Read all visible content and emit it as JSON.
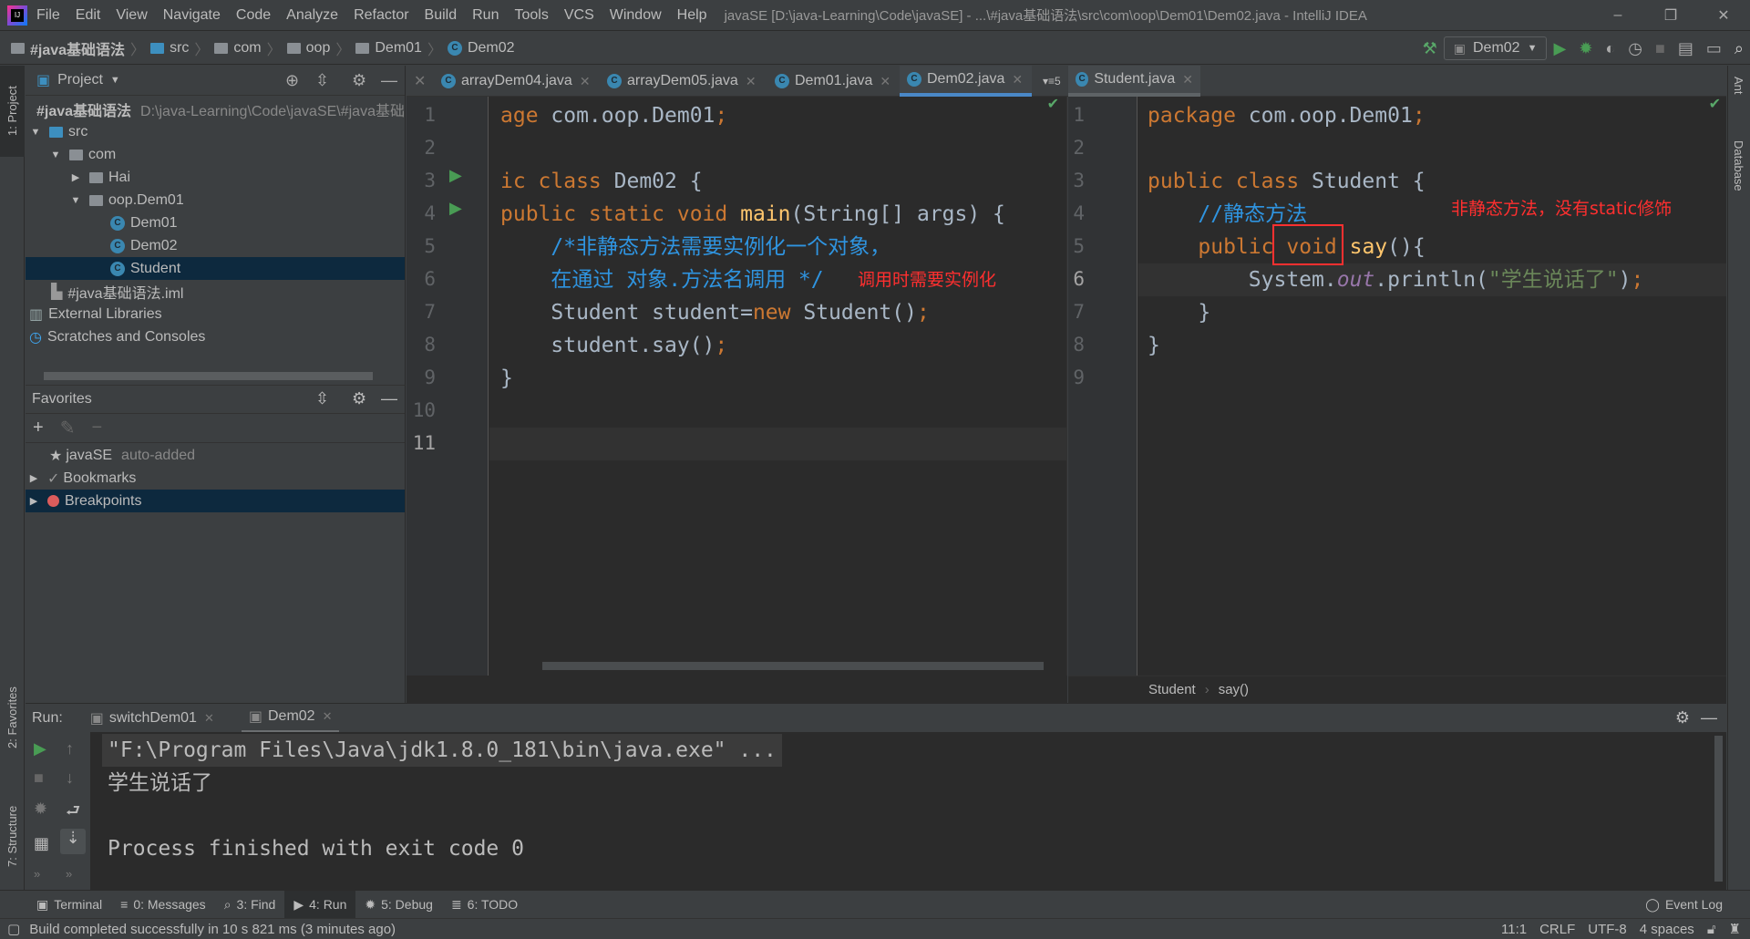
{
  "window": {
    "title": "javaSE [D:\\java-Learning\\Code\\javaSE] - ...\\#java基础语法\\src\\com\\oop\\Dem01\\Dem02.java - IntelliJ IDEA",
    "minimize": "–",
    "restore": "❐",
    "close": "✕"
  },
  "menu": [
    "File",
    "Edit",
    "View",
    "Navigate",
    "Code",
    "Analyze",
    "Refactor",
    "Build",
    "Run",
    "Tools",
    "VCS",
    "Window",
    "Help"
  ],
  "breadcrumb": [
    "#java基础语法",
    "src",
    "com",
    "oop",
    "Dem01",
    "Dem02"
  ],
  "run_config": "Dem02",
  "left_stripe": {
    "project": "1: Project",
    "favorites": "2: Favorites",
    "structure": "7: Structure"
  },
  "right_stripe": {
    "ant": "Ant",
    "database": "Database"
  },
  "project": {
    "title": "Project",
    "tree": [
      {
        "label": "#java基础语法",
        "extra": "D:\\java-Learning\\Code\\javaSE\\#java基础语法"
      },
      {
        "label": "src"
      },
      {
        "label": "com"
      },
      {
        "label": "Hai"
      },
      {
        "label": "oop.Dem01"
      },
      {
        "label": "Dem01"
      },
      {
        "label": "Dem02"
      },
      {
        "label": "Student"
      },
      {
        "label": "#java基础语法.iml"
      },
      {
        "label": "External Libraries"
      },
      {
        "label": "Scratches and Consoles"
      }
    ]
  },
  "favorites": {
    "title": "Favorites",
    "items": [
      {
        "label": "javaSE",
        "extra": "auto-added"
      },
      {
        "label": "Bookmarks"
      },
      {
        "label": "Breakpoints"
      }
    ]
  },
  "tabs": [
    "arrayDem04.java",
    "arrayDem05.java",
    "Dem01.java",
    "Dem02.java",
    "Student.java"
  ],
  "tab_overflow": "5",
  "left_editor": {
    "lines": [
      [
        [
          "age",
          "kw"
        ],
        [
          " com.oop.Dem01",
          "tx"
        ],
        [
          ";",
          "kw"
        ]
      ],
      [],
      [
        [
          "ic class",
          "kw"
        ],
        [
          " Dem02 {",
          "tx"
        ]
      ],
      [
        [
          "public static void",
          "kw"
        ],
        [
          " ",
          "tx"
        ],
        [
          "main",
          "fn"
        ],
        [
          "(String[] args) {",
          "tx"
        ]
      ],
      [
        [
          "    /*非静态方法需要实例化一个对象，",
          "cm"
        ]
      ],
      [
        [
          "    在通过 对象.方法名调用 */",
          "cm"
        ]
      ],
      [
        [
          "    Student student=",
          "tx"
        ],
        [
          "new",
          "kw"
        ],
        [
          " Student()",
          "tx"
        ],
        [
          ";",
          "kw"
        ]
      ],
      [
        [
          "    student.say()",
          "tx"
        ],
        [
          ";",
          "kw"
        ]
      ],
      [
        [
          "}",
          "tx"
        ]
      ],
      [],
      []
    ],
    "current_line": 11,
    "annotation": "调用时需要实例化"
  },
  "right_editor": {
    "lines": [
      [
        [
          "package",
          "kw"
        ],
        [
          " com.oop.Dem01",
          "tx"
        ],
        [
          ";",
          "kw"
        ]
      ],
      [],
      [
        [
          "public class",
          "kw"
        ],
        [
          " Student {",
          "tx"
        ]
      ],
      [
        [
          "    //静态方法",
          "cm"
        ]
      ],
      [
        [
          "    public",
          "kw"
        ],
        [
          " ",
          "tx"
        ],
        [
          "void",
          "kw"
        ],
        [
          " ",
          "tx"
        ],
        [
          "say",
          "fn"
        ],
        [
          "(){",
          "tx"
        ]
      ],
      [
        [
          "        System.",
          "tx"
        ],
        [
          "out",
          "fld"
        ],
        [
          ".println(",
          "tx"
        ],
        [
          "\"学生说话了\"",
          "st"
        ],
        [
          ")",
          "tx"
        ],
        [
          ";",
          "kw"
        ]
      ],
      [
        [
          "    }",
          "tx"
        ]
      ],
      [
        [
          "}",
          "tx"
        ]
      ],
      []
    ],
    "current_line": 6,
    "annotation": "非静态方法，没有static修饰",
    "breadcrumb": [
      "Student",
      "say()"
    ]
  },
  "run": {
    "label": "Run:",
    "tabs": [
      "switchDem01",
      "Dem02"
    ],
    "output": [
      "\"F:\\Program Files\\Java\\jdk1.8.0_181\\bin\\java.exe\" ...",
      "学生说话了",
      "",
      "Process finished with exit code 0"
    ]
  },
  "tool_windows": [
    "Terminal",
    "0: Messages",
    "3: Find",
    "4: Run",
    "5: Debug",
    "6: TODO"
  ],
  "event_log": "Event Log",
  "status": {
    "message": "Build completed successfully in 10 s 821 ms (3 minutes ago)",
    "position": "11:1",
    "line_sep": "CRLF",
    "encoding": "UTF-8",
    "indent": "4 spaces"
  },
  "colors": {
    "keyword": "#cc7832",
    "comment": "#2f94e0",
    "string": "#6a8759",
    "annotation": "#ff2f2f",
    "selection": "#0d293e",
    "accent": "#4a88c7"
  }
}
